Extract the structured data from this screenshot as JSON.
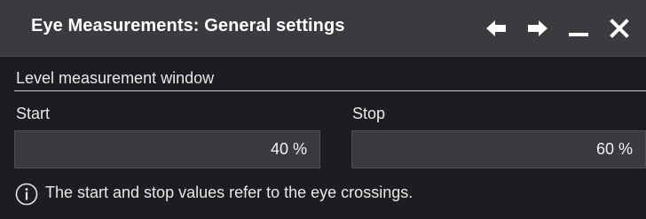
{
  "window": {
    "title": "Eye Measurements: General settings"
  },
  "titlebar_buttons": {
    "back_icon": "arrow-left-icon",
    "forward_icon": "arrow-right-icon",
    "minimize_icon": "minimize-icon",
    "close_icon": "close-icon"
  },
  "section": {
    "title": "Level measurement window"
  },
  "start": {
    "label": "Start",
    "value": "40 %"
  },
  "stop": {
    "label": "Stop",
    "value": "60 %"
  },
  "info": {
    "icon": "info-icon",
    "text": "The start and stop values refer to the eye crossings."
  },
  "colors": {
    "titlebar_bg": "#3a3b3f",
    "dialog_bg": "#1c1d20",
    "field_bg": "#3a3b3f",
    "text": "#e6e6e6"
  }
}
